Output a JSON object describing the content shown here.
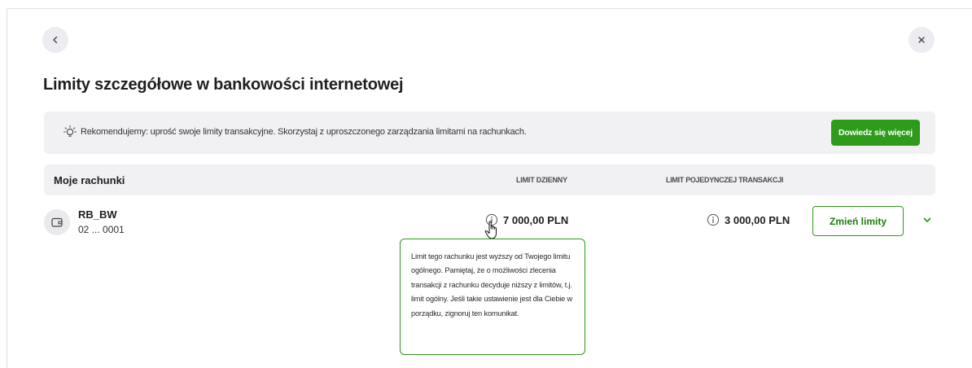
{
  "navigation": {
    "back_icon": "chevron-left-icon",
    "close_icon": "close-icon"
  },
  "page": {
    "title": "Limity szczegółowe w bankowości internetowej"
  },
  "banner": {
    "icon": "lightbulb-icon",
    "text": "Rekomendujemy: uprość swoje limity transakcyjne. Skorzystaj z uproszczonego zarządzania limitami na rachunkach.",
    "button_label": "Dowiedz się więcej"
  },
  "table": {
    "headers": {
      "accounts": "Moje rachunki",
      "daily_limit": "LIMIT DZIENNY",
      "single_limit": "LIMIT POJEDYNCZEJ TRANSAKCJI"
    },
    "rows": [
      {
        "icon": "wallet-icon",
        "name": "RB_BW",
        "number": "02 ... 0001",
        "daily_limit": "7 000,00 PLN",
        "single_limit": "3 000,00 PLN",
        "action_label": "Zmień limity",
        "expand_icon": "chevron-down-icon"
      }
    ]
  },
  "tooltip": {
    "text": "Limit tego rachunku jest wyższy od Twojego limitu ogólnego. Pamiętaj, że o możliwości zlecenia transakcji z rachunku decyduje niższy z limitów, t.j. limit ogólny. Jeśli takie ustawienie jest dla Ciebie w porządku, zignoruj ten komunikat."
  },
  "colors": {
    "accent_green": "#2e9b1b",
    "panel_gray": "#f1f1f4"
  }
}
